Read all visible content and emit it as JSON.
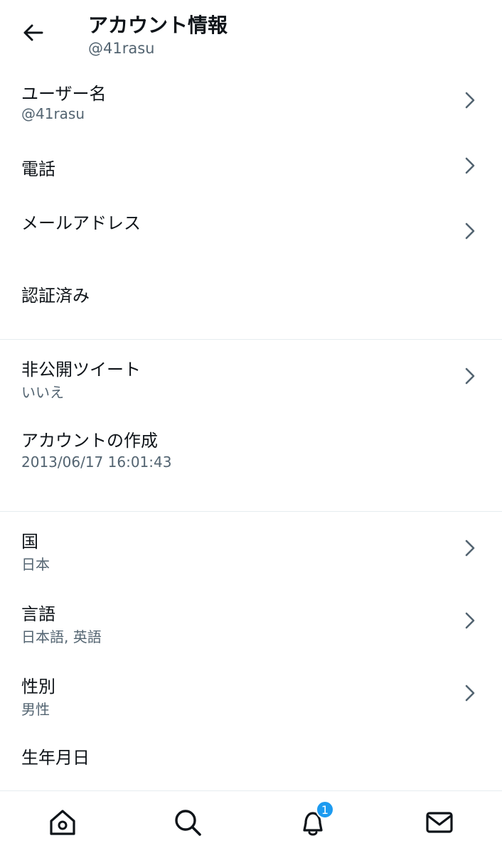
{
  "header": {
    "title": "アカウント情報",
    "handle": "@41rasu"
  },
  "rows": {
    "username": {
      "label": "ユーザー名",
      "value": "@41rasu"
    },
    "phone": {
      "label": "電話"
    },
    "email": {
      "label": "メールアドレス"
    },
    "verified": {
      "label": "認証済み"
    },
    "protected": {
      "label": "非公開ツイート",
      "value": "いいえ"
    },
    "created": {
      "label": "アカウントの作成",
      "value": "2013/06/17 16:01:43"
    },
    "country": {
      "label": "国",
      "value": "日本"
    },
    "languages": {
      "label": "言語",
      "value": "日本語, 英語"
    },
    "gender": {
      "label": "性別",
      "value": "男性"
    },
    "birthday": {
      "label": "生年月日"
    }
  },
  "tabbar": {
    "notification_badge": "1",
    "icons": [
      "home-icon",
      "search-icon",
      "bell-icon",
      "mail-icon"
    ]
  },
  "colors": {
    "text": "#0f1419",
    "secondary": "#536471",
    "accent": "#1d9bf0",
    "divider": "#e6ecf0"
  }
}
